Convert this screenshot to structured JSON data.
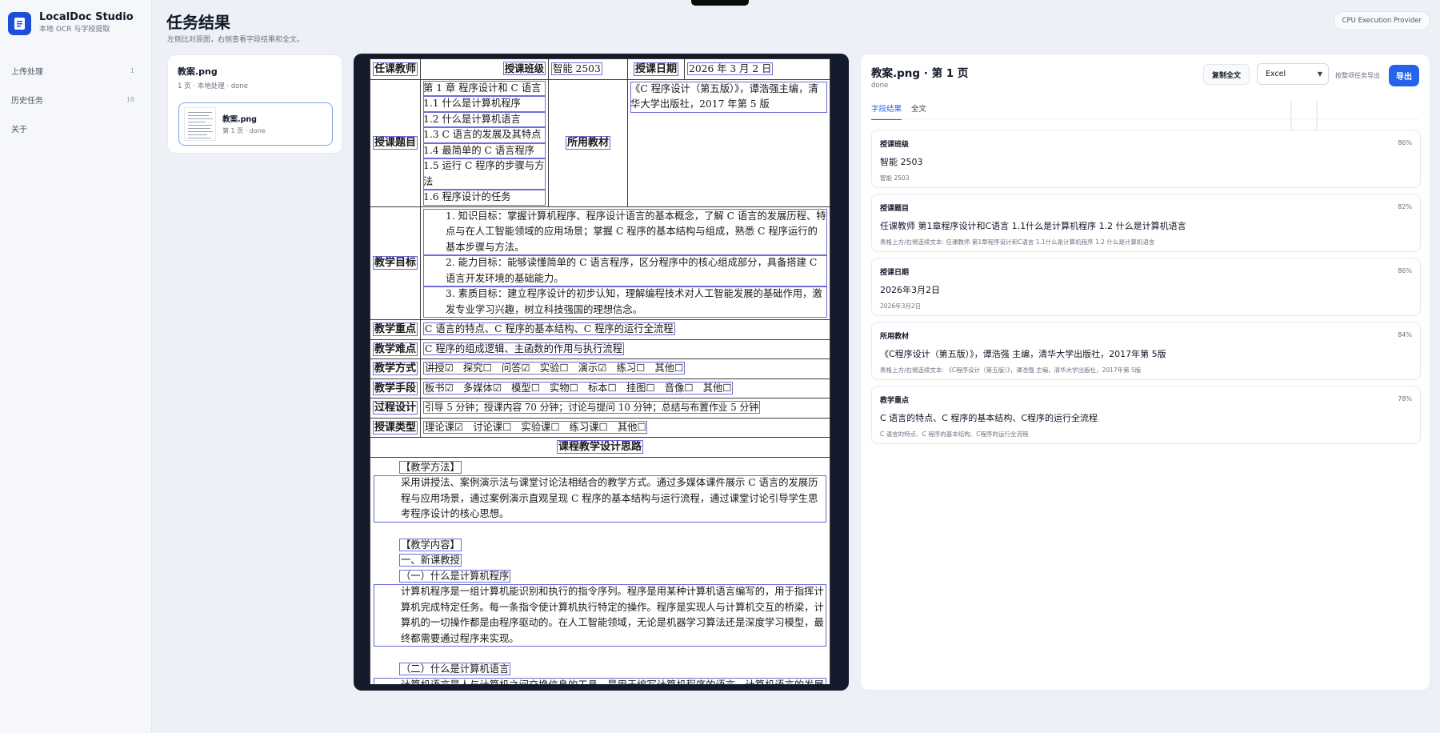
{
  "app": {
    "name": "LocalDoc Studio",
    "subtitle": "本地 OCR 与字段提取"
  },
  "nav": [
    {
      "label": "上传处理",
      "count": "1"
    },
    {
      "label": "历史任务",
      "count": "18"
    },
    {
      "label": "关于",
      "count": ""
    }
  ],
  "page": {
    "title": "任务结果",
    "subtitle": "左侧比对原图，右侧查看字段结果和全文。"
  },
  "provider": "CPU Execution Provider",
  "file_panel": {
    "name": "教案.png",
    "meta": "1 页 · 本地处理 · done",
    "page_card": {
      "name": "教案.png",
      "meta": "第 1 页 · done"
    }
  },
  "doc": {
    "r1": {
      "teacher_label": "任课教师",
      "teacher_value": "",
      "class_label": "授课班级",
      "class_value": "智能 2503",
      "date_label": "授课日期",
      "date_value": "2026 年 3 月 2 日"
    },
    "topic_label": "授课题目",
    "topics": [
      "第 1 章 程序设计和 C 语言",
      "1.1 什么是计算机程序",
      "1.2 什么是计算机语言",
      "1.3 C 语言的发展及其特点",
      "1.4 最简单的 C 语言程序",
      "1.5 运行 C 程序的步骤与方法",
      "1.6 程序设计的任务"
    ],
    "book_label": "所用教材",
    "book_value": "《C 程序设计（第五版）》，谭浩强主编，清华大学出版社，2017 年第 5 版",
    "goal_label": "教学目标",
    "goals": [
      "1. 知识目标：掌握计算机程序、程序设计语言的基本概念，了解 C 语言的发展历程、特点与在人工智能领域的应用场景；掌握 C 程序的基本结构与组成，熟悉 C 程序运行的基本步骤与方法。",
      "2. 能力目标：能够读懂简单的 C 语言程序，区分程序中的核心组成部分，具备搭建 C 语言开发环境的基础能力。",
      "3. 素质目标：建立程序设计的初步认知，理解编程技术对人工智能发展的基础作用，激发专业学习兴趣，树立科技强国的理想信念。"
    ],
    "key_label": "教学重点",
    "key_value": "C 语言的特点、C 程序的基本结构、C 程序的运行全流程",
    "diff_label": "教学难点",
    "diff_value": "C 程序的组成逻辑、主函数的作用与执行流程",
    "method_label": "教学方式",
    "method_value": "讲授☑　探究☐　问答☑　实验☐　演示☑　练习☐　其他☐",
    "means_label": "教学手段",
    "means_value": "板书☑　多媒体☑　模型☐　实物☐　标本☐　挂图☐　音像☐　其他☐",
    "process_label": "过程设计",
    "process_value": "引导 5 分钟；授课内容 70 分钟；讨论与提问 10 分钟；总结与布置作业 5 分钟",
    "type_label": "授课类型",
    "type_value": "理论课☑　讨论课☐　实验课☐　练习课☐　其他☐",
    "design_title": "课程教学设计思路",
    "method_head": "【教学方法】",
    "method_text": "采用讲授法、案例演示法与课堂讨论法相结合的教学方式。通过多媒体课件展示 C 语言的发展历程与应用场景，通过案例演示直观呈现 C 程序的基本结构与运行流程，通过课堂讨论引导学生思考程序设计的核心思想。",
    "content_head": "【教学内容】",
    "sec1": "一、新课教授",
    "sub1": "（一）什么是计算机程序",
    "sub1_text": "计算机程序是一组计算机能识别和执行的指令序列。程序是用某种计算机语言编写的，用于指挥计算机完成特定任务。每一条指令使计算机执行特定的操作。程序是实现人与计算机交互的桥梁，计算机的一切操作都是由程序驱动的。在人工智能领域，无论是机器学习算法还是深度学习模型，最终都需要通过程序来实现。",
    "sub2": "（二）什么是计算机语言",
    "sub2_text": "计算机语言是人与计算机之间交换信息的工具，是用于编写计算机程序的语言。计算机语言的发展经历了三个阶段。"
  },
  "results": {
    "title": "教案.png · 第 1 页",
    "status": "done",
    "copy_label": "复制全文",
    "format": "Excel",
    "format_hint": "按整项任务导出",
    "export_label": "导出",
    "tabs": [
      "字段结果",
      "全文"
    ],
    "fields": [
      {
        "label": "授课班级",
        "confidence": "86%",
        "value": "智能 2503",
        "raw": "智能 2503"
      },
      {
        "label": "授课题目",
        "confidence": "82%",
        "value": "任课教师 第1章程序设计和C语言 1.1什么是计算机程序 1.2 什么是计算机语言",
        "raw": "表格上方/右侧连续文本: 任课教师 第1章程序设计和C语言 1.1什么是计算机程序 1.2 什么是计算机语言"
      },
      {
        "label": "授课日期",
        "confidence": "86%",
        "value": "2026年3月2日",
        "raw": "2026年3月2日"
      },
      {
        "label": "所用教材",
        "confidence": "84%",
        "value": "《C程序设计（第五版）》，谭浩强 主编，清华大学出版社，2017年第 5版",
        "raw": "表格上方/右侧连续文本: 《C程序设计（第五版）》，谭浩强 主编，清华大学出版社，2017年第 5版"
      },
      {
        "label": "教学重点",
        "confidence": "78%",
        "value": "C 语言的特点、C 程序的基本结构、C程序的运行全流程",
        "raw": "C 语言的特点、C 程序的基本结构、C程序的运行全流程"
      }
    ]
  }
}
